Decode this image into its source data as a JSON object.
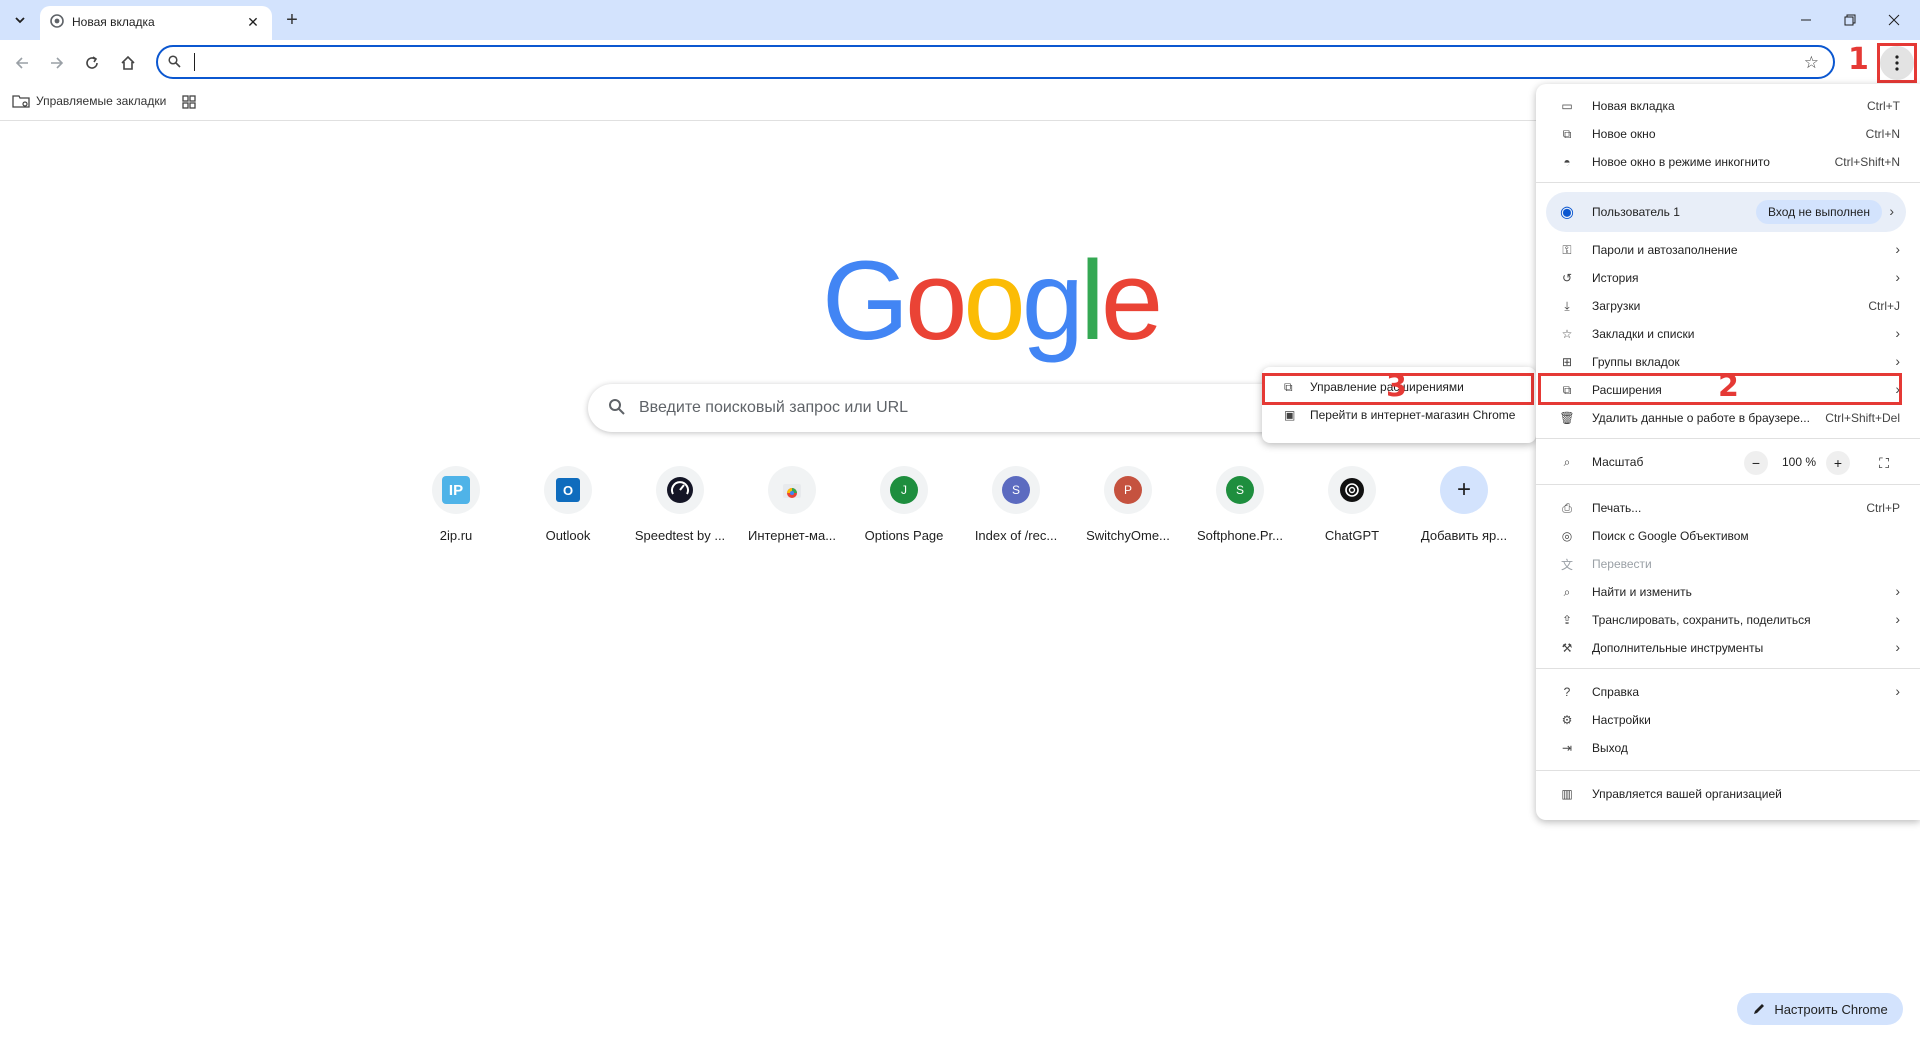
{
  "tab": {
    "title": "Новая вкладка"
  },
  "omnibox": {
    "value": ""
  },
  "bookmarks": {
    "managed_label": "Управляемые закладки"
  },
  "google_logo": [
    "G",
    "o",
    "o",
    "g",
    "l",
    "e"
  ],
  "search": {
    "placeholder": "Введите поисковый запрос или URL"
  },
  "shortcuts": [
    {
      "label": "2ip.ru"
    },
    {
      "label": "Outlook"
    },
    {
      "label": "Speedtest by ..."
    },
    {
      "label": "Интернет-ма..."
    },
    {
      "label": "Options Page",
      "letter": "J"
    },
    {
      "label": "Index of /rec...",
      "letter": "S"
    },
    {
      "label": "SwitchyOme...",
      "letter": "P"
    },
    {
      "label": "Softphone.Pr...",
      "letter": "S"
    },
    {
      "label": "ChatGPT"
    },
    {
      "label": "Добавить яр..."
    }
  ],
  "menu": {
    "new_tab": {
      "label": "Новая вкладка",
      "shortcut": "Ctrl+T"
    },
    "new_window": {
      "label": "Новое окно",
      "shortcut": "Ctrl+N"
    },
    "incognito": {
      "label": "Новое окно в режиме инкогнито",
      "shortcut": "Ctrl+Shift+N"
    },
    "profile": {
      "name": "Пользователь 1",
      "status": "Вход не выполнен"
    },
    "passwords": {
      "label": "Пароли и автозаполнение"
    },
    "history": {
      "label": "История"
    },
    "downloads": {
      "label": "Загрузки",
      "shortcut": "Ctrl+J"
    },
    "bookmarks": {
      "label": "Закладки и списки"
    },
    "tab_groups": {
      "label": "Группы вкладок"
    },
    "extensions": {
      "label": "Расширения"
    },
    "clear_data": {
      "label": "Удалить данные о работе в браузере...",
      "shortcut": "Ctrl+Shift+Del"
    },
    "zoom": {
      "label": "Масштаб",
      "value": "100 %",
      "minus": "−",
      "plus": "+"
    },
    "print": {
      "label": "Печать...",
      "shortcut": "Ctrl+P"
    },
    "lens": {
      "label": "Поиск с Google Объективом"
    },
    "translate": {
      "label": "Перевести"
    },
    "find": {
      "label": "Найти и изменить"
    },
    "cast": {
      "label": "Транслировать, сохранить, поделиться"
    },
    "more_tools": {
      "label": "Дополнительные инструменты"
    },
    "help": {
      "label": "Справка"
    },
    "settings": {
      "label": "Настройки"
    },
    "exit": {
      "label": "Выход"
    },
    "managed": {
      "label": "Управляется вашей организацией"
    }
  },
  "submenu": {
    "manage": {
      "label": "Управление расширениями"
    },
    "store": {
      "label": "Перейти в интернет-магазин Chrome"
    }
  },
  "annotations": [
    "1",
    "2",
    "3"
  ],
  "customize": {
    "label": "Настроить Chrome"
  },
  "colors": {
    "accent": "#0b57d0",
    "annotation": "#e53935",
    "titlebar": "#d3e3fd"
  }
}
